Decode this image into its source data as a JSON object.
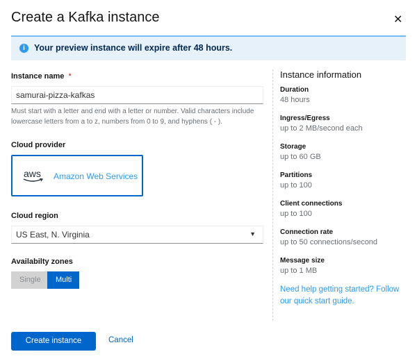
{
  "title": "Create a Kafka instance",
  "alert": "Your preview instance will expire after 48 hours.",
  "form": {
    "name_label": "Instance name",
    "required": "*",
    "name_value": "samurai-pizza-kafkas",
    "name_help_1": "Must start with a letter and end with a letter or number. Valid characters include",
    "name_help_2": "lowercase letters from a to z, numbers from 0 to 9, and hyphens ( - ).",
    "provider_label": "Cloud provider",
    "provider_logo": "aws",
    "provider_name": "Amazon Web Services",
    "region_label": "Cloud region",
    "region_value": "US East, N. Virginia",
    "zones_label": "Availabilty zones",
    "zones": [
      "Single",
      "Multi"
    ],
    "zones_selected": "Multi"
  },
  "info": {
    "title": "Instance information",
    "items": [
      {
        "k": "Duration",
        "v": "48 hours"
      },
      {
        "k": "Ingress/Egress",
        "v": "up to 2 MB/second each"
      },
      {
        "k": "Storage",
        "v": "up to 60 GB"
      },
      {
        "k": "Partitions",
        "v": "up to 100"
      },
      {
        "k": "Client connections",
        "v": "up to 100"
      },
      {
        "k": "Connection rate",
        "v": "up to 50 connections/second"
      },
      {
        "k": "Message size",
        "v": "up to 1 MB"
      }
    ],
    "help": "Need help getting started? Follow our quick start guide."
  },
  "footer": {
    "create": "Create instance",
    "cancel": "Cancel"
  },
  "colors": {
    "primary": "#0066cc",
    "link": "#2b9af3",
    "alert_bg": "#e7f1fa"
  }
}
